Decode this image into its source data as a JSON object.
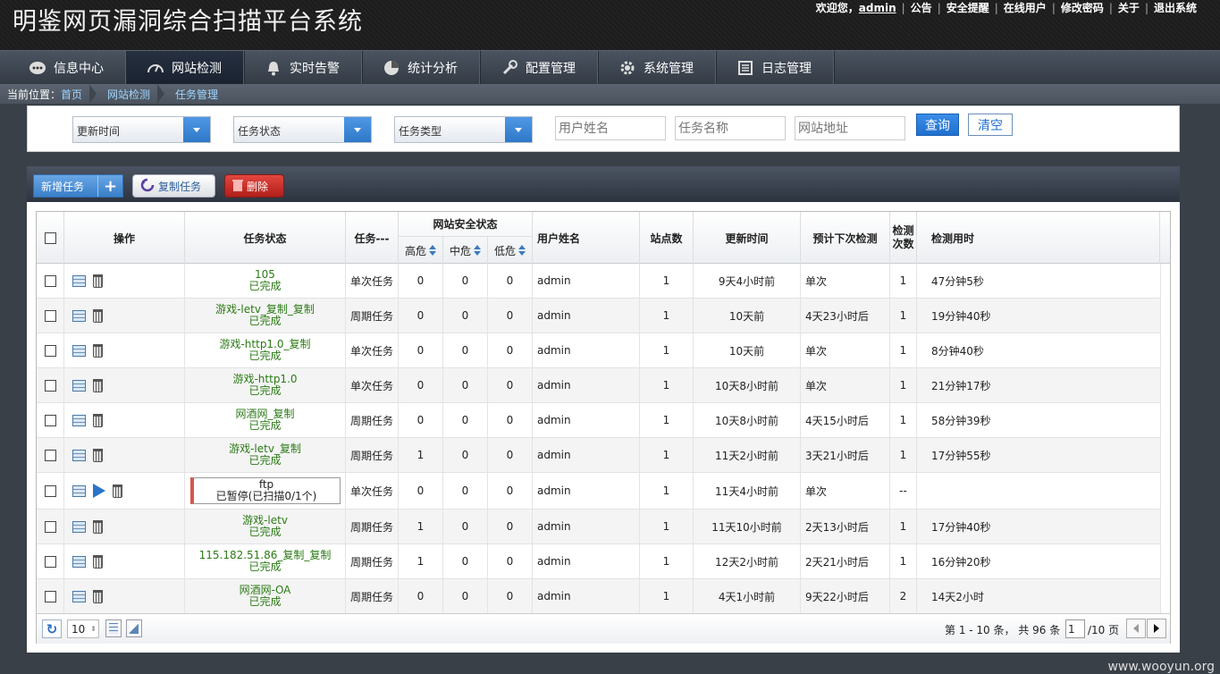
{
  "header": {
    "app_title": "明鉴网页漏洞综合扫描平台系统",
    "welcome": "欢迎您，",
    "username": "admin",
    "links": [
      "公告",
      "安全提醒",
      "在线用户",
      "修改密码",
      "关于",
      "退出系统"
    ]
  },
  "nav": {
    "items": [
      {
        "label": "信息中心",
        "icon": "chat-bubble-icon"
      },
      {
        "label": "网站检测",
        "icon": "gauge-icon",
        "active": true
      },
      {
        "label": "实时告警",
        "icon": "bell-icon"
      },
      {
        "label": "统计分析",
        "icon": "pie-chart-icon"
      },
      {
        "label": "配置管理",
        "icon": "wrench-icon"
      },
      {
        "label": "系统管理",
        "icon": "gear-icon"
      },
      {
        "label": "日志管理",
        "icon": "log-icon"
      }
    ]
  },
  "breadcrumb": {
    "prefix": "当前位置：",
    "items": [
      "首页",
      "网站检测",
      "任务管理"
    ]
  },
  "filters": {
    "update_time": "更新时间",
    "task_status": "任务状态",
    "task_type": "任务类型",
    "user_placeholder": "用户姓名",
    "task_name_placeholder": "任务名称",
    "site_url_placeholder": "网站地址",
    "query_label": "查询",
    "clear_label": "清空"
  },
  "toolbar": {
    "add_label": "新增任务",
    "copy_label": "复制任务",
    "delete_label": "删除"
  },
  "table": {
    "headers": {
      "action": "操作",
      "status": "任务状态",
      "type": "任务---",
      "security": "网站安全状态",
      "high": "高危",
      "mid": "中危",
      "low": "低危",
      "user": "用户姓名",
      "sites": "站点数",
      "updated": "更新时间",
      "next": "预计下次检测",
      "count": "检测次数",
      "duration": "检测用时"
    },
    "rows": [
      {
        "name": "105",
        "state": "已完成",
        "type": "单次任务",
        "high": "0",
        "mid": "0",
        "low": "0",
        "user": "admin",
        "sites": "1",
        "updated": "9天4小时前",
        "next": "单次",
        "count": "1",
        "duration": "47分钟5秒"
      },
      {
        "name": "游戏-letv_复制_复制",
        "state": "已完成",
        "type": "周期任务",
        "high": "0",
        "mid": "0",
        "low": "0",
        "user": "admin",
        "sites": "1",
        "updated": "10天前",
        "next": "4天23小时后",
        "count": "1",
        "duration": "19分钟40秒"
      },
      {
        "name": "游戏-http1.0_复制",
        "state": "已完成",
        "type": "单次任务",
        "high": "0",
        "mid": "0",
        "low": "0",
        "user": "admin",
        "sites": "1",
        "updated": "10天前",
        "next": "单次",
        "count": "1",
        "duration": "8分钟40秒"
      },
      {
        "name": "游戏-http1.0",
        "state": "已完成",
        "type": "单次任务",
        "high": "0",
        "mid": "0",
        "low": "0",
        "user": "admin",
        "sites": "1",
        "updated": "10天8小时前",
        "next": "单次",
        "count": "1",
        "duration": "21分钟17秒"
      },
      {
        "name": "网酒网_复制",
        "state": "已完成",
        "type": "周期任务",
        "high": "0",
        "mid": "0",
        "low": "0",
        "user": "admin",
        "sites": "1",
        "updated": "10天8小时前",
        "next": "4天15小时后",
        "count": "1",
        "duration": "58分钟39秒"
      },
      {
        "name": "游戏-letv_复制",
        "state": "已完成",
        "type": "周期任务",
        "high": "1",
        "mid": "0",
        "low": "0",
        "user": "admin",
        "sites": "1",
        "updated": "11天2小时前",
        "next": "3天21小时后",
        "count": "1",
        "duration": "17分钟55秒"
      },
      {
        "name": "ftp",
        "state": "已暂停(已扫描0/1个)",
        "type": "单次任务",
        "high": "0",
        "mid": "0",
        "low": "0",
        "user": "admin",
        "sites": "1",
        "updated": "11天4小时前",
        "next": "单次",
        "count": "--",
        "duration": "",
        "paused": true
      },
      {
        "name": "游戏-letv",
        "state": "已完成",
        "type": "周期任务",
        "high": "1",
        "mid": "0",
        "low": "0",
        "user": "admin",
        "sites": "1",
        "updated": "11天10小时前",
        "next": "2天13小时后",
        "count": "1",
        "duration": "17分钟40秒"
      },
      {
        "name": "115.182.51.86_复制_复制",
        "state": "已完成",
        "type": "周期任务",
        "high": "1",
        "mid": "0",
        "low": "0",
        "user": "admin",
        "sites": "1",
        "updated": "12天2小时前",
        "next": "2天21小时后",
        "count": "1",
        "duration": "16分钟20秒"
      },
      {
        "name": "网酒网-OA",
        "state": "已完成",
        "type": "周期任务",
        "high": "0",
        "mid": "0",
        "low": "0",
        "user": "admin",
        "sites": "1",
        "updated": "4天1小时前",
        "next": "9天22小时后",
        "count": "2",
        "duration": "14天2小时"
      }
    ]
  },
  "pager": {
    "page_size": "10",
    "info": "第 1 - 10 条，  共 96 条",
    "current_page": "1",
    "total_pages": "/10 页"
  },
  "watermark": "www.wooyun.org",
  "colors": {
    "status_green": "#2b7a16",
    "accent_blue": "#2f78c8",
    "paused_red": "#d9534f"
  }
}
